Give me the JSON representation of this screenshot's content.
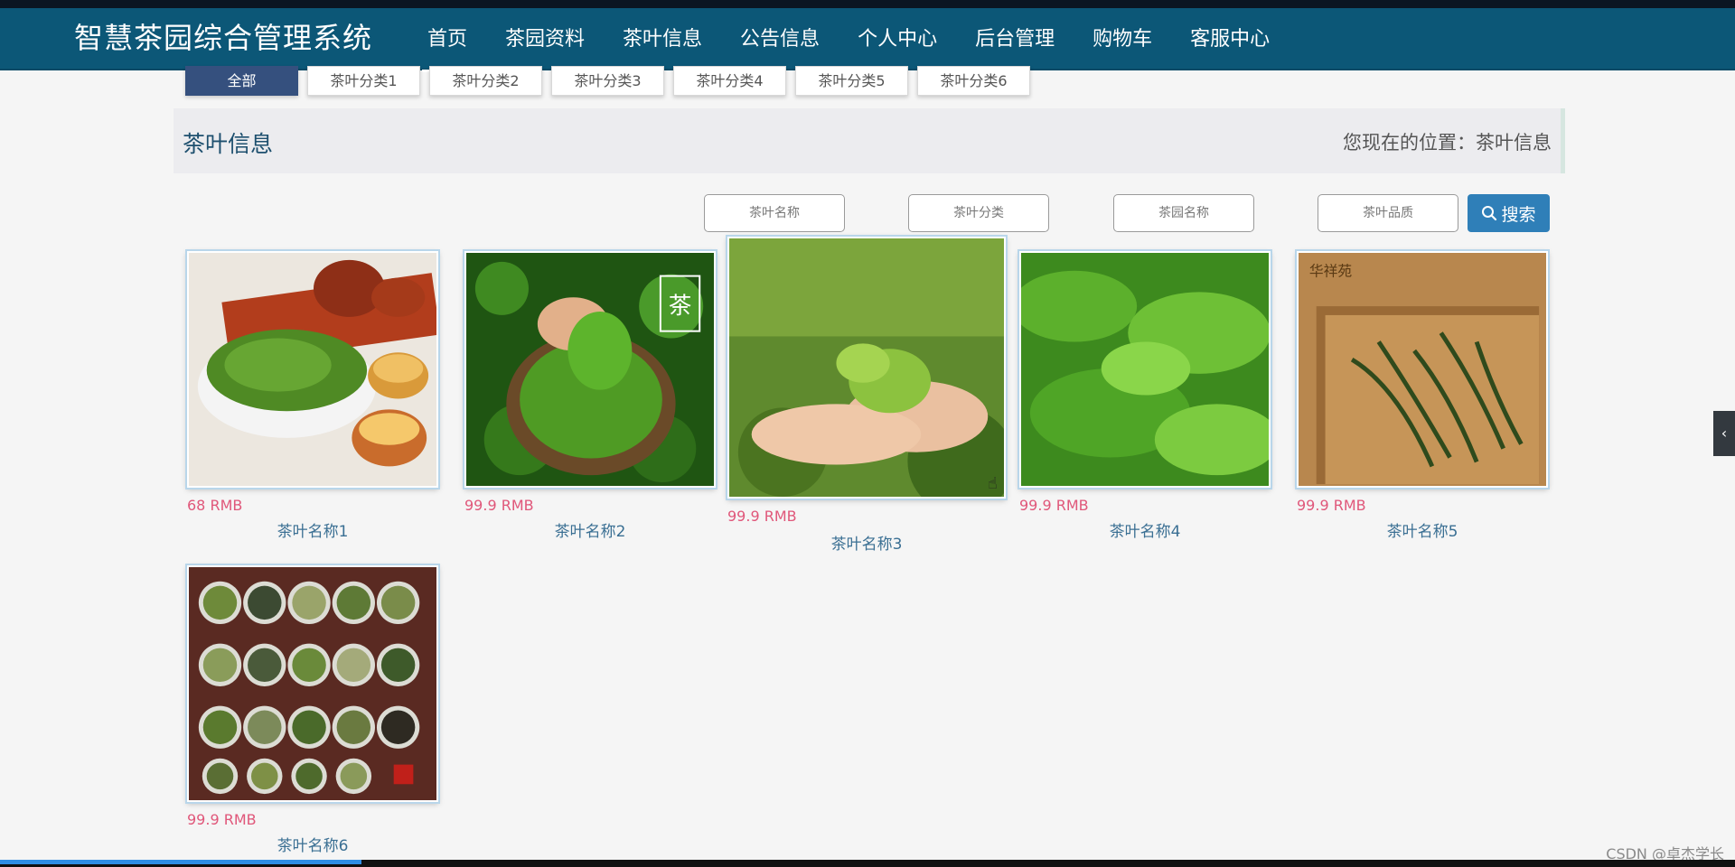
{
  "header": {
    "brand": "智慧茶园综合管理系统",
    "menu": [
      "首页",
      "茶园资料",
      "茶叶信息",
      "公告信息",
      "个人中心",
      "后台管理",
      "购物车",
      "客服中心"
    ]
  },
  "categories": [
    "全部",
    "茶叶分类1",
    "茶叶分类2",
    "茶叶分类3",
    "茶叶分类4",
    "茶叶分类5",
    "茶叶分类6"
  ],
  "page": {
    "title": "茶叶信息",
    "breadcrumb": "您现在的位置：茶叶信息"
  },
  "search": {
    "placeholders": [
      "茶叶名称",
      "茶叶分类",
      "茶园名称",
      "茶叶品质"
    ],
    "button_label": "搜索"
  },
  "products": [
    {
      "name": "茶叶名称1",
      "price": "68 RMB"
    },
    {
      "name": "茶叶名称2",
      "price": "99.9 RMB"
    },
    {
      "name": "茶叶名称3",
      "price": "99.9 RMB"
    },
    {
      "name": "茶叶名称4",
      "price": "99.9 RMB"
    },
    {
      "name": "茶叶名称5",
      "price": "99.9 RMB"
    },
    {
      "name": "茶叶名称6",
      "price": "99.9 RMB"
    }
  ],
  "image_badges": {
    "p2": "茶",
    "p5": "华祥苑"
  },
  "watermark": "CSDN @卓杰学长",
  "colors": {
    "navbar": "#0c5777",
    "active_category": "#35507e",
    "price": "#e0577a",
    "search_button": "#2f7fb8"
  }
}
